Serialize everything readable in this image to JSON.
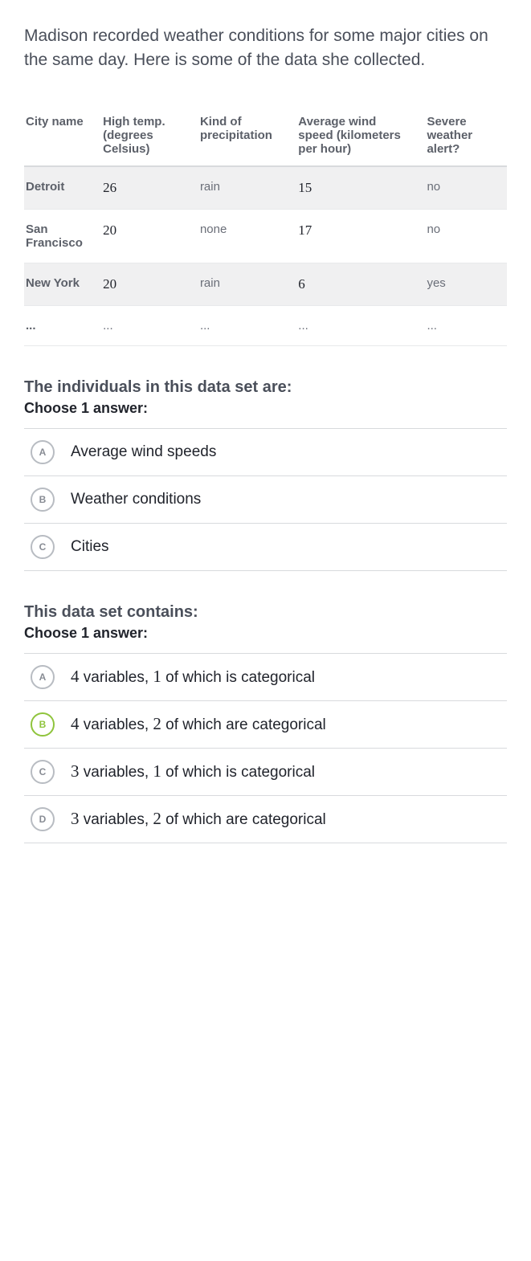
{
  "intro": "Madison recorded weather conditions for some major cities on the same day. Here is some of the data she collected.",
  "table": {
    "headers": [
      "City name",
      "High temp. (degrees Celsius)",
      "Kind of precipitation",
      "Average wind speed (kilometers per hour)",
      "Severe weather alert?"
    ],
    "rows": [
      {
        "c0": "Detroit",
        "c1": "26",
        "c2": "rain",
        "c3": "15",
        "c4": "no"
      },
      {
        "c0": "San Francisco",
        "c1": "20",
        "c2": "none",
        "c3": "17",
        "c4": "no"
      },
      {
        "c0": "New York",
        "c1": "20",
        "c2": "rain",
        "c3": "6",
        "c4": "yes"
      },
      {
        "c0": "...",
        "c1": "...",
        "c2": "...",
        "c3": "...",
        "c4": "..."
      }
    ]
  },
  "q1": {
    "prompt": "The individuals in this data set are:",
    "instruct": "Choose 1 answer:",
    "choices": [
      {
        "letter": "A",
        "text": "Average wind speeds",
        "selected": false
      },
      {
        "letter": "B",
        "text": "Weather conditions",
        "selected": false
      },
      {
        "letter": "C",
        "text": "Cities",
        "selected": false
      }
    ]
  },
  "q2": {
    "prompt": "This data set contains:",
    "instruct": "Choose 1 answer:",
    "choices": [
      {
        "letter": "A",
        "n1": "4",
        "mid": " variables, ",
        "n2": "1",
        "tail": " of which is categorical",
        "selected": false
      },
      {
        "letter": "B",
        "n1": "4",
        "mid": " variables, ",
        "n2": "2",
        "tail": " of which are categorical",
        "selected": true
      },
      {
        "letter": "C",
        "n1": "3",
        "mid": " variables, ",
        "n2": "1",
        "tail": " of which is categorical",
        "selected": false
      },
      {
        "letter": "D",
        "n1": "3",
        "mid": " variables, ",
        "n2": "2",
        "tail": " of which are categorical",
        "selected": false
      }
    ]
  }
}
